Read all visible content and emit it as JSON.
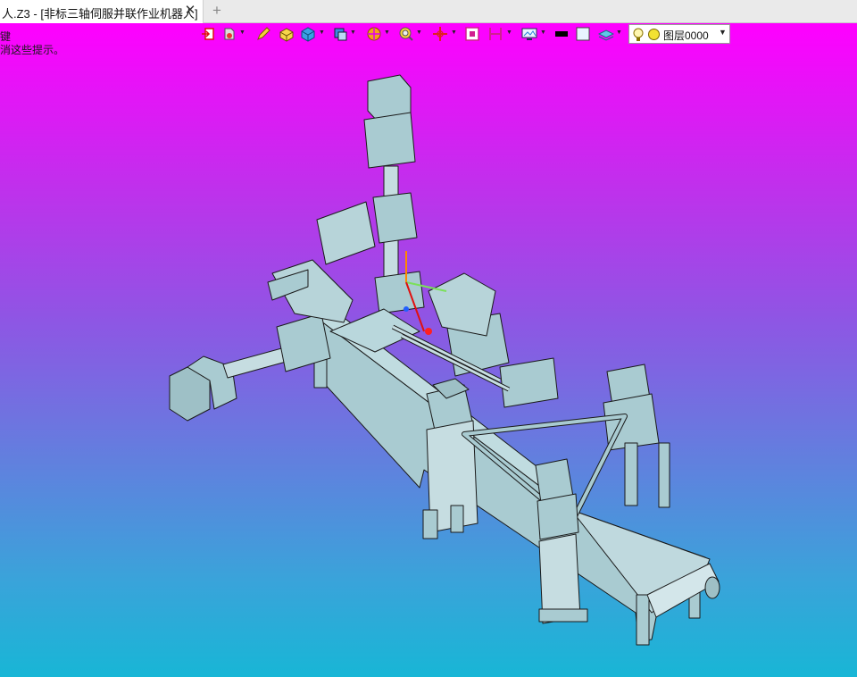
{
  "tab": {
    "title": "人.Z3 - [非标三轴伺服并联作业机器人]",
    "close_icon": "close-icon",
    "add_icon": "plus-icon"
  },
  "hints": {
    "line1": "键",
    "line2": "消这些提示。"
  },
  "toolbar": {
    "icons": [
      "exit-sketch-icon",
      "style-icon",
      "pencil-icon",
      "box-icon",
      "solid-cube-icon",
      "view-cube-icon",
      "render-mode-icon",
      "zoom-icon",
      "pan-icon",
      "frame-icon",
      "section-icon",
      "display-icon",
      "color-black-icon",
      "color-white-icon",
      "layer-visibility-icon"
    ],
    "layer": {
      "label": "图层0000",
      "light_icon": "lightbulb-icon",
      "sun_icon": "layer-color-icon"
    }
  },
  "colors": {
    "viewport_top": "#ff00ff",
    "viewport_bottom": "#18b6d6",
    "model_face": "#a9cbd1",
    "model_edge": "#1a1a1a"
  }
}
